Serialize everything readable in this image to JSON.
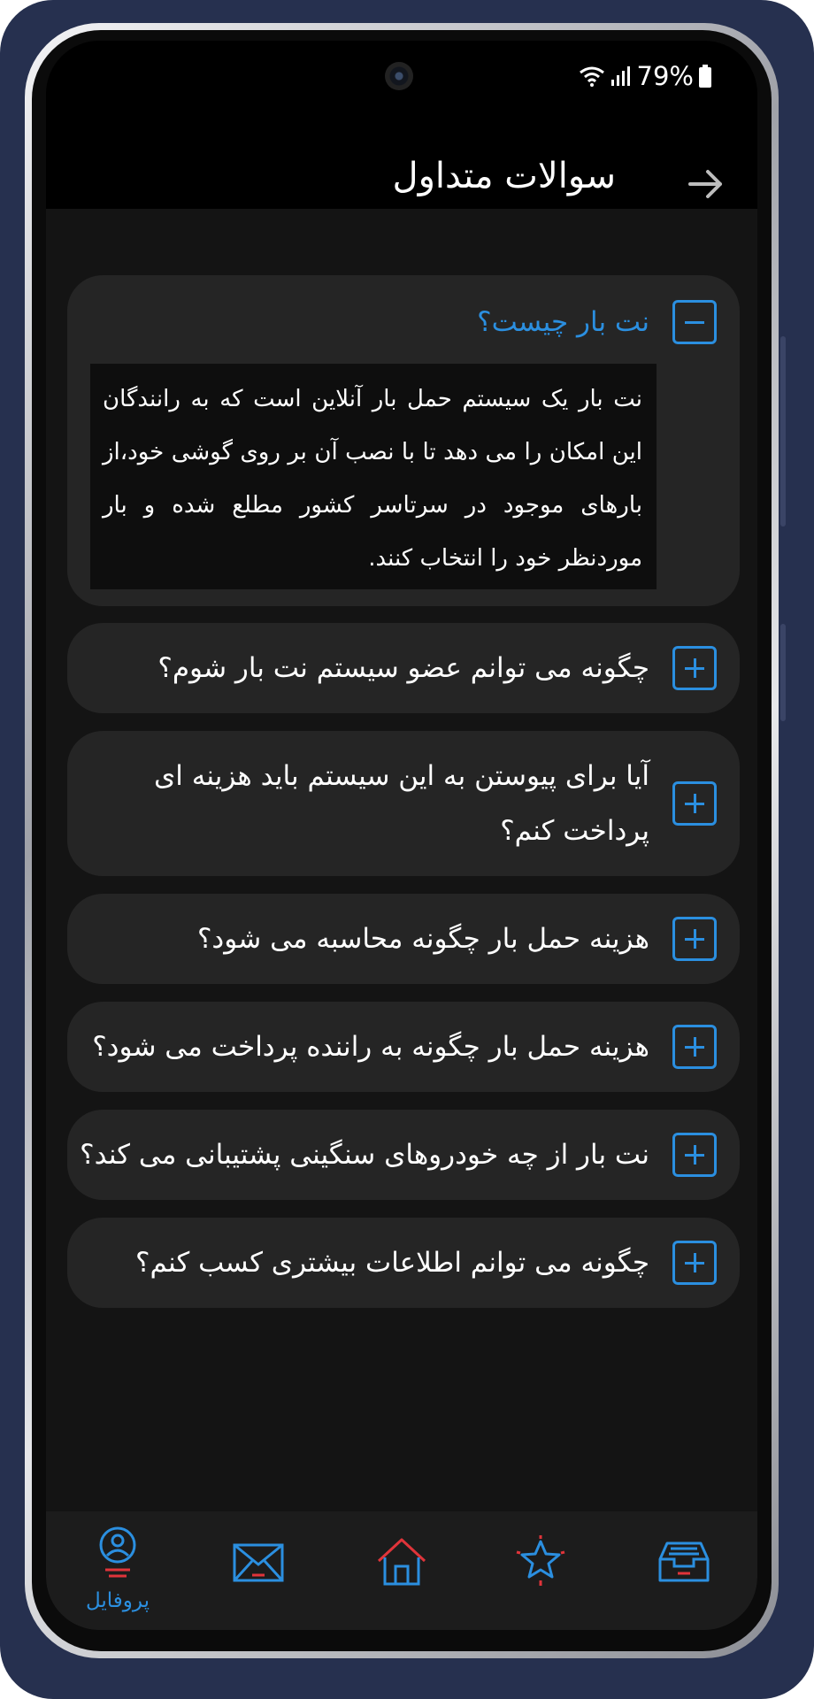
{
  "status_bar": {
    "battery_text": "79%"
  },
  "header": {
    "title": "سوالات متداول",
    "back_icon": "arrow-back-icon"
  },
  "faq": [
    {
      "question": "نت بار چیست؟",
      "expanded": true,
      "answer": "نت بار یک سیستم حمل بار آنلاین است که به رانندگان این امکان را می دهد تا با نصب آن بر روی گوشی خود،از بارهای موجود در سرتاسر کشور مطلع شده و بار موردنظر خود را انتخاب کنند."
    },
    {
      "question": "چگونه می توانم عضو سیستم نت بار شوم؟",
      "expanded": false
    },
    {
      "question": "آیا برای پیوستن به این سیستم باید هزینه ای پرداخت کنم؟",
      "expanded": false
    },
    {
      "question": "هزینه حمل بار چگونه محاسبه می شود؟",
      "expanded": false
    },
    {
      "question": "هزینه حمل بار چگونه به راننده پرداخت می شود؟",
      "expanded": false
    },
    {
      "question": "نت بار از چه خودروهای سنگینی پشتیبانی می کند؟",
      "expanded": false
    },
    {
      "question": "چگونه می توانم اطلاعات بیشتری کسب کنم؟",
      "expanded": false
    }
  ],
  "bottom_nav": {
    "profile": {
      "label": "پروفایل",
      "icon": "profile-icon",
      "active": true
    },
    "messages": {
      "icon": "envelope-icon"
    },
    "home": {
      "icon": "home-icon"
    },
    "favorites": {
      "icon": "star-icon"
    },
    "inbox": {
      "icon": "inbox-tray-icon"
    }
  },
  "colors": {
    "accent": "#2b8fe0",
    "alert": "#e0343a",
    "card": "#252525",
    "background": "#141414"
  }
}
